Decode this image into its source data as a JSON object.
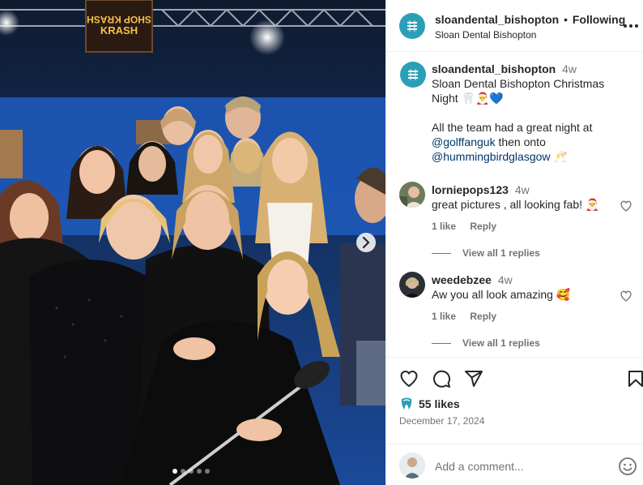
{
  "post": {
    "account": "sloandental_bishopton",
    "follow_state": "Following",
    "location": "Sloan Dental Bishopton",
    "caption_time": "4w",
    "caption_line1": "Sloan Dental Bishopton Christmas",
    "caption_line2": "Night 🦷🎅💙",
    "caption_line3": "All the team had a great night at",
    "mention1": "@golffanguk",
    "caption_line4": " then onto",
    "mention2": "@hummingbirdglasgow",
    "caption_line5": " 🥂",
    "sign_text": "SHOP KRASH"
  },
  "comments": [
    {
      "username": "lorniepops123",
      "time": "4w",
      "text": "great pictures , all looking fab! 🎅",
      "likes": "1 like",
      "reply": "Reply",
      "view_replies": "View all 1 replies"
    },
    {
      "username": "weedebzee",
      "time": "4w",
      "text": "Aw you all look amazing 🥰",
      "likes": "1 like",
      "reply": "Reply",
      "view_replies": "View all 1 replies"
    }
  ],
  "footer": {
    "likes": "55 likes",
    "date": "December 17, 2024",
    "comment_placeholder": "Add a comment..."
  },
  "carousel": {
    "slide_count": 5,
    "active_index": 0
  },
  "icons": {
    "heart": "heart-icon",
    "comment": "comment-icon",
    "share": "share-icon",
    "save": "bookmark-icon",
    "more": "more-icon",
    "next": "chevron-right-icon",
    "emoji": "emoji-icon",
    "like_avatar": "tooth-logo-icon"
  },
  "colors": {
    "accent_link": "#00376b",
    "muted": "#737373",
    "brand_teal": "#2a9fb5"
  }
}
